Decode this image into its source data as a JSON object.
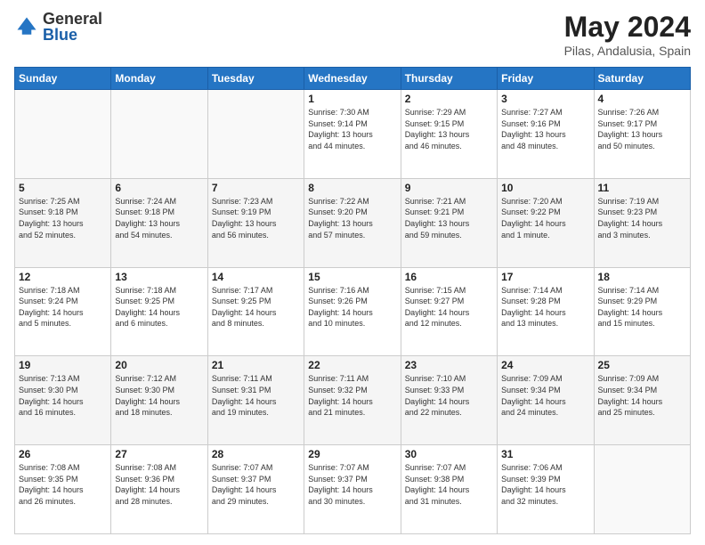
{
  "header": {
    "logo_general": "General",
    "logo_blue": "Blue",
    "title": "May 2024",
    "subtitle": "Pilas, Andalusia, Spain"
  },
  "days_of_week": [
    "Sunday",
    "Monday",
    "Tuesday",
    "Wednesday",
    "Thursday",
    "Friday",
    "Saturday"
  ],
  "weeks": [
    [
      {
        "day": "",
        "info": ""
      },
      {
        "day": "",
        "info": ""
      },
      {
        "day": "",
        "info": ""
      },
      {
        "day": "1",
        "info": "Sunrise: 7:30 AM\nSunset: 9:14 PM\nDaylight: 13 hours\nand 44 minutes."
      },
      {
        "day": "2",
        "info": "Sunrise: 7:29 AM\nSunset: 9:15 PM\nDaylight: 13 hours\nand 46 minutes."
      },
      {
        "day": "3",
        "info": "Sunrise: 7:27 AM\nSunset: 9:16 PM\nDaylight: 13 hours\nand 48 minutes."
      },
      {
        "day": "4",
        "info": "Sunrise: 7:26 AM\nSunset: 9:17 PM\nDaylight: 13 hours\nand 50 minutes."
      }
    ],
    [
      {
        "day": "5",
        "info": "Sunrise: 7:25 AM\nSunset: 9:18 PM\nDaylight: 13 hours\nand 52 minutes."
      },
      {
        "day": "6",
        "info": "Sunrise: 7:24 AM\nSunset: 9:18 PM\nDaylight: 13 hours\nand 54 minutes."
      },
      {
        "day": "7",
        "info": "Sunrise: 7:23 AM\nSunset: 9:19 PM\nDaylight: 13 hours\nand 56 minutes."
      },
      {
        "day": "8",
        "info": "Sunrise: 7:22 AM\nSunset: 9:20 PM\nDaylight: 13 hours\nand 57 minutes."
      },
      {
        "day": "9",
        "info": "Sunrise: 7:21 AM\nSunset: 9:21 PM\nDaylight: 13 hours\nand 59 minutes."
      },
      {
        "day": "10",
        "info": "Sunrise: 7:20 AM\nSunset: 9:22 PM\nDaylight: 14 hours\nand 1 minute."
      },
      {
        "day": "11",
        "info": "Sunrise: 7:19 AM\nSunset: 9:23 PM\nDaylight: 14 hours\nand 3 minutes."
      }
    ],
    [
      {
        "day": "12",
        "info": "Sunrise: 7:18 AM\nSunset: 9:24 PM\nDaylight: 14 hours\nand 5 minutes."
      },
      {
        "day": "13",
        "info": "Sunrise: 7:18 AM\nSunset: 9:25 PM\nDaylight: 14 hours\nand 6 minutes."
      },
      {
        "day": "14",
        "info": "Sunrise: 7:17 AM\nSunset: 9:25 PM\nDaylight: 14 hours\nand 8 minutes."
      },
      {
        "day": "15",
        "info": "Sunrise: 7:16 AM\nSunset: 9:26 PM\nDaylight: 14 hours\nand 10 minutes."
      },
      {
        "day": "16",
        "info": "Sunrise: 7:15 AM\nSunset: 9:27 PM\nDaylight: 14 hours\nand 12 minutes."
      },
      {
        "day": "17",
        "info": "Sunrise: 7:14 AM\nSunset: 9:28 PM\nDaylight: 14 hours\nand 13 minutes."
      },
      {
        "day": "18",
        "info": "Sunrise: 7:14 AM\nSunset: 9:29 PM\nDaylight: 14 hours\nand 15 minutes."
      }
    ],
    [
      {
        "day": "19",
        "info": "Sunrise: 7:13 AM\nSunset: 9:30 PM\nDaylight: 14 hours\nand 16 minutes."
      },
      {
        "day": "20",
        "info": "Sunrise: 7:12 AM\nSunset: 9:30 PM\nDaylight: 14 hours\nand 18 minutes."
      },
      {
        "day": "21",
        "info": "Sunrise: 7:11 AM\nSunset: 9:31 PM\nDaylight: 14 hours\nand 19 minutes."
      },
      {
        "day": "22",
        "info": "Sunrise: 7:11 AM\nSunset: 9:32 PM\nDaylight: 14 hours\nand 21 minutes."
      },
      {
        "day": "23",
        "info": "Sunrise: 7:10 AM\nSunset: 9:33 PM\nDaylight: 14 hours\nand 22 minutes."
      },
      {
        "day": "24",
        "info": "Sunrise: 7:09 AM\nSunset: 9:34 PM\nDaylight: 14 hours\nand 24 minutes."
      },
      {
        "day": "25",
        "info": "Sunrise: 7:09 AM\nSunset: 9:34 PM\nDaylight: 14 hours\nand 25 minutes."
      }
    ],
    [
      {
        "day": "26",
        "info": "Sunrise: 7:08 AM\nSunset: 9:35 PM\nDaylight: 14 hours\nand 26 minutes."
      },
      {
        "day": "27",
        "info": "Sunrise: 7:08 AM\nSunset: 9:36 PM\nDaylight: 14 hours\nand 28 minutes."
      },
      {
        "day": "28",
        "info": "Sunrise: 7:07 AM\nSunset: 9:37 PM\nDaylight: 14 hours\nand 29 minutes."
      },
      {
        "day": "29",
        "info": "Sunrise: 7:07 AM\nSunset: 9:37 PM\nDaylight: 14 hours\nand 30 minutes."
      },
      {
        "day": "30",
        "info": "Sunrise: 7:07 AM\nSunset: 9:38 PM\nDaylight: 14 hours\nand 31 minutes."
      },
      {
        "day": "31",
        "info": "Sunrise: 7:06 AM\nSunset: 9:39 PM\nDaylight: 14 hours\nand 32 minutes."
      },
      {
        "day": "",
        "info": ""
      }
    ]
  ]
}
